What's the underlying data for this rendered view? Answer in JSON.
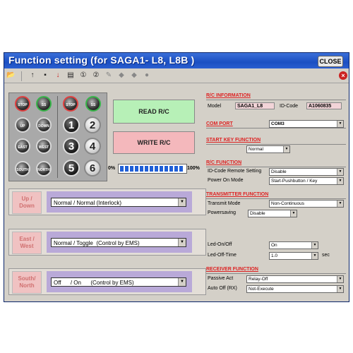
{
  "window": {
    "title": "Function setting (for SAGA1- L8, L8B )",
    "close_label": "CLOSE"
  },
  "keypad": {
    "small_keys": [
      "STOP",
      "SS",
      "STOP",
      "SS",
      "UP",
      "DOWN",
      "EAST",
      "WEST",
      "SOUTH",
      "NORTH"
    ],
    "numbers": [
      "1",
      "2",
      "3",
      "4",
      "5",
      "6"
    ]
  },
  "actions": {
    "read_label": "READ  R/C",
    "write_label": "WRITE  R/C"
  },
  "progress": {
    "min_label": "0%",
    "max_label": "100%",
    "value": 1.0
  },
  "groups": [
    {
      "button": "Up /\nDown",
      "value": "Normal / Normal (Interlock)"
    },
    {
      "button": "East /\nWest",
      "value": "Normal / Toggle  (Control by EMS)"
    },
    {
      "button": "South/\nNorth",
      "value": "Off      / On      (Control by EMS)"
    }
  ],
  "rc_info": {
    "heading": "R/C INFORMATION",
    "model_label": "Model",
    "model_value": "SAGA1_L8",
    "id_label": "ID-Code",
    "id_value": "A1060835"
  },
  "com_port": {
    "heading": "COM  PORT",
    "value": "COM3"
  },
  "start_key": {
    "heading": "START KEY FUNCTION",
    "value": "Normal"
  },
  "rc_function": {
    "heading": "R/C  FUNCTION",
    "rows": [
      {
        "label": "ID-Code Remote Setting",
        "value": "Disable"
      },
      {
        "label": "Power On Mode",
        "value": "Start-Pushbutton / Key"
      }
    ]
  },
  "transmitter": {
    "heading": "TRANSMITTER FUNCTION",
    "transmit_mode_label": "Transmit Mode",
    "transmit_mode_value": "Non-Continuous",
    "powersaving_label": "Powersaving",
    "powersaving_value": "Disable",
    "led_on_label": "Led-On/Off",
    "led_on_value": "On",
    "led_off_label": "Led-Off-Time",
    "led_off_value": "1.0",
    "led_off_unit": "sec"
  },
  "receiver": {
    "heading": "RECEIVER  FUNCTION",
    "passive_label": "Passive Act",
    "passive_value": "Relay-Off",
    "auto_off_label": "Auto Off (RX)",
    "auto_off_value": "Not-Execute"
  },
  "toolbar_icons": [
    "folder-open-icon",
    "arrow-up-icon",
    "save-icon",
    "arrow-down-icon",
    "printer-icon",
    "info-1-icon",
    "info-2-icon",
    "pencil-icon",
    "tag-1-icon",
    "tag-2-icon",
    "circle-icon",
    "close-icon"
  ]
}
